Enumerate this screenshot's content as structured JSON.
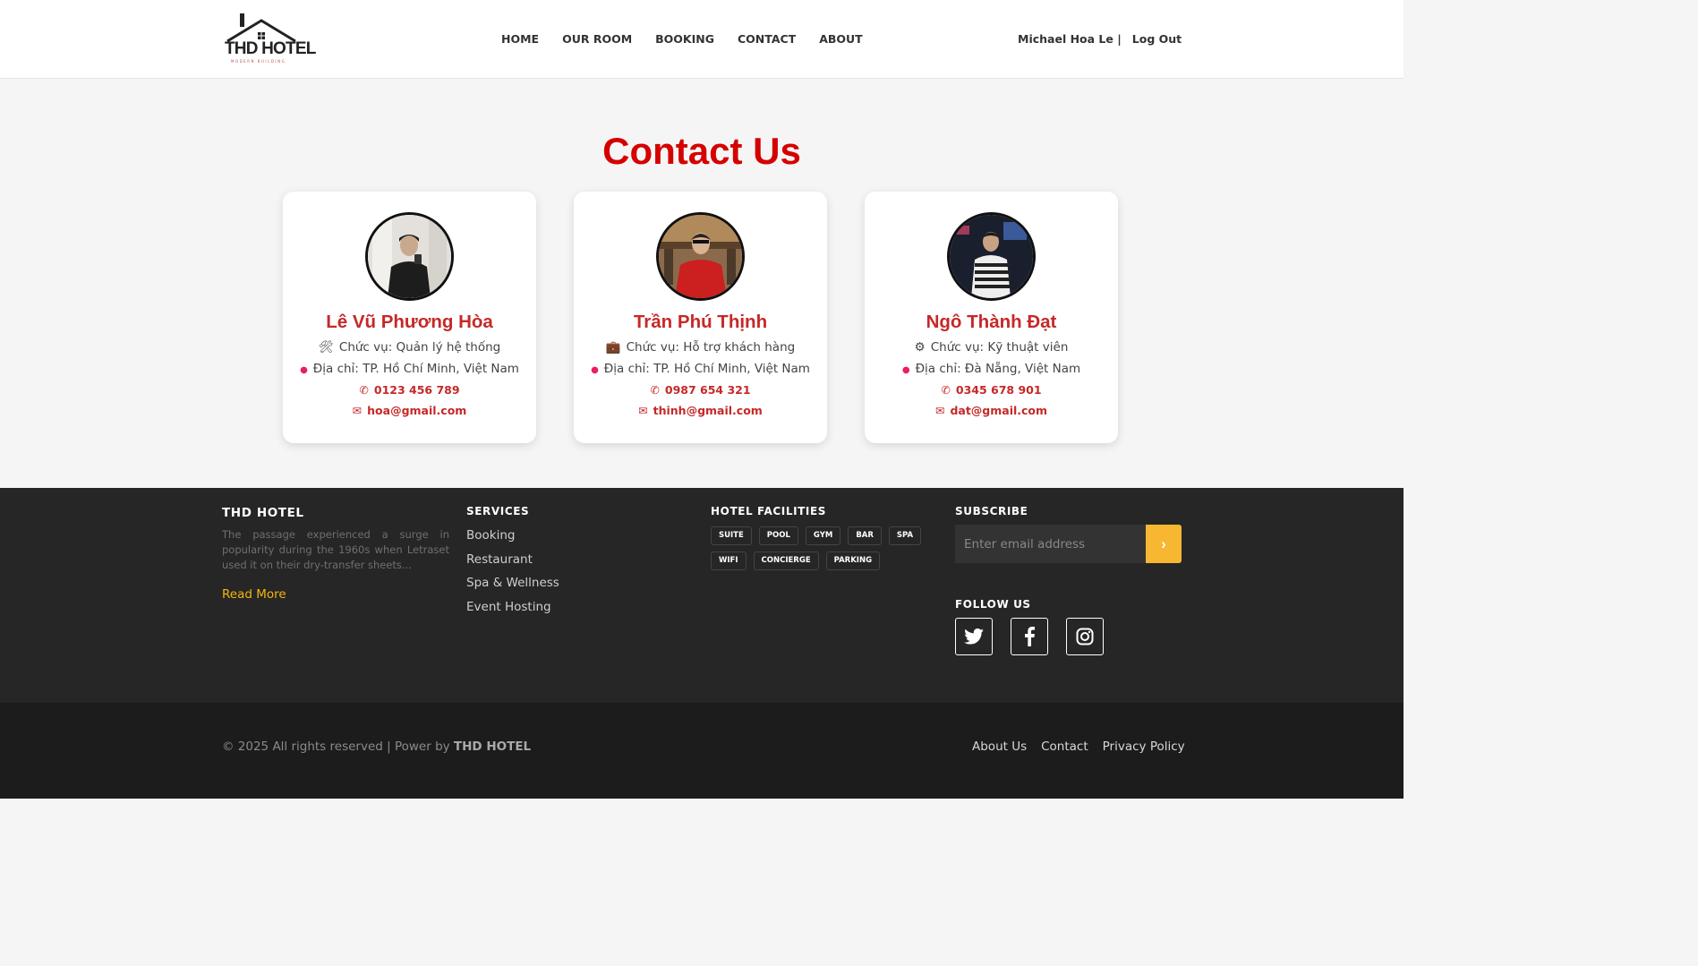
{
  "header": {
    "logo_text": "THD HOTEL",
    "logo_subtext": "MODERN BUILDING",
    "nav": [
      "HOME",
      "OUR ROOM",
      "BOOKING",
      "CONTACT",
      "ABOUT"
    ],
    "user_name": "Michael Hoa Le |",
    "logout_label": "Log Out"
  },
  "main": {
    "title": "Contact Us",
    "cards": [
      {
        "name": "Lê Vũ Phương Hòa",
        "role_icon": "🛠",
        "role": "Chức vụ: Quản lý hệ thống",
        "address": "Địa chỉ: TP. Hồ Chí Minh, Việt Nam",
        "phone": "0123 456 789",
        "email": "hoa@gmail.com"
      },
      {
        "name": "Trần Phú Thịnh",
        "role_icon": "💼",
        "role": "Chức vụ: Hỗ trợ khách hàng",
        "address": "Địa chỉ: TP. Hồ Chí Minh, Việt Nam",
        "phone": "0987 654 321",
        "email": "thinh@gmail.com"
      },
      {
        "name": "Ngô Thành Đạt",
        "role_icon": "⚙",
        "role": "Chức vụ: Kỹ thuật viên",
        "address": "Địa chỉ: Đà Nẵng, Việt Nam",
        "phone": "0345 678 901",
        "email": "dat@gmail.com"
      }
    ]
  },
  "footer": {
    "about_title": "THD HOTEL",
    "about_text": "The passage experienced a surge in popularity during the 1960s when Letraset used it on their dry-transfer sheets...",
    "read_more": "Read More",
    "services_title": "SERVICES",
    "services": [
      "Booking",
      "Restaurant",
      "Spa & Wellness",
      "Event Hosting"
    ],
    "facilities_title": "HOTEL FACILITIES",
    "facilities": [
      "SUITE",
      "POOL",
      "GYM",
      "BAR",
      "SPA",
      "WIFI",
      "CONCIERGE",
      "PARKING"
    ],
    "subscribe_title": "SUBSCRIBE",
    "subscribe_placeholder": "Enter email address",
    "follow_title": "FOLLOW US",
    "socials": [
      "twitter-icon",
      "facebook-icon",
      "instagram-icon"
    ],
    "copyright_prefix": "© 2025 All rights reserved | Power by ",
    "copyright_brand": "THD HOTEL",
    "bottom_links": [
      "About Us",
      "Contact",
      "Privacy Policy"
    ]
  },
  "colors": {
    "accent_red": "#d50000",
    "accent_gold": "#f7b731",
    "footer_bg": "#262626",
    "bottom_bg": "#1c1c1c"
  }
}
